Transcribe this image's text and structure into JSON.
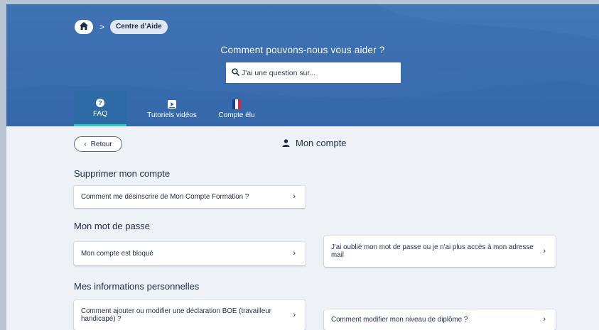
{
  "breadcrumb": {
    "home_icon": "home-icon",
    "separator": ">",
    "current": "Centre d'Aide"
  },
  "hero": {
    "title": "Comment pouvons-nous vous aider ?",
    "search": {
      "icon": "search-icon",
      "placeholder": "J'ai une question sur..."
    }
  },
  "tabs": [
    {
      "label": "FAQ",
      "icon": "question-circle-icon",
      "active": true
    },
    {
      "label": "Tutoriels vidéos",
      "icon": "video-play-icon",
      "active": false
    },
    {
      "label": "Compte élu",
      "icon": "french-flag-icon",
      "active": false
    }
  ],
  "back_button": {
    "label": "Retour",
    "icon": "chevron-left-icon"
  },
  "page_heading": {
    "label": "Mon compte",
    "icon": "user-icon"
  },
  "sections": [
    {
      "title": "Supprimer mon compte",
      "cards": [
        {
          "label": "Comment me désinscrire de Mon Compte Formation ?"
        }
      ]
    },
    {
      "title": "Mon mot de passe",
      "cards": [
        {
          "label": "Mon compte est bloqué"
        },
        {
          "label": "J'ai oublié mon mot de passe ou je n'ai plus accès à mon adresse mail"
        }
      ]
    },
    {
      "title": "Mes informations personnelles",
      "cards": [
        {
          "label": "Comment ajouter ou modifier une déclaration BOE (travailleur handicapé) ?"
        },
        {
          "label": "Comment modifier mon niveau de diplôme ?"
        }
      ]
    }
  ],
  "colors": {
    "hero_blue": "#3a6cae",
    "active_tab": "#2d6aa6",
    "tab_underline": "#2fc6c6",
    "page_bg": "#eef1f6",
    "text_dark": "#1d2e4a"
  }
}
